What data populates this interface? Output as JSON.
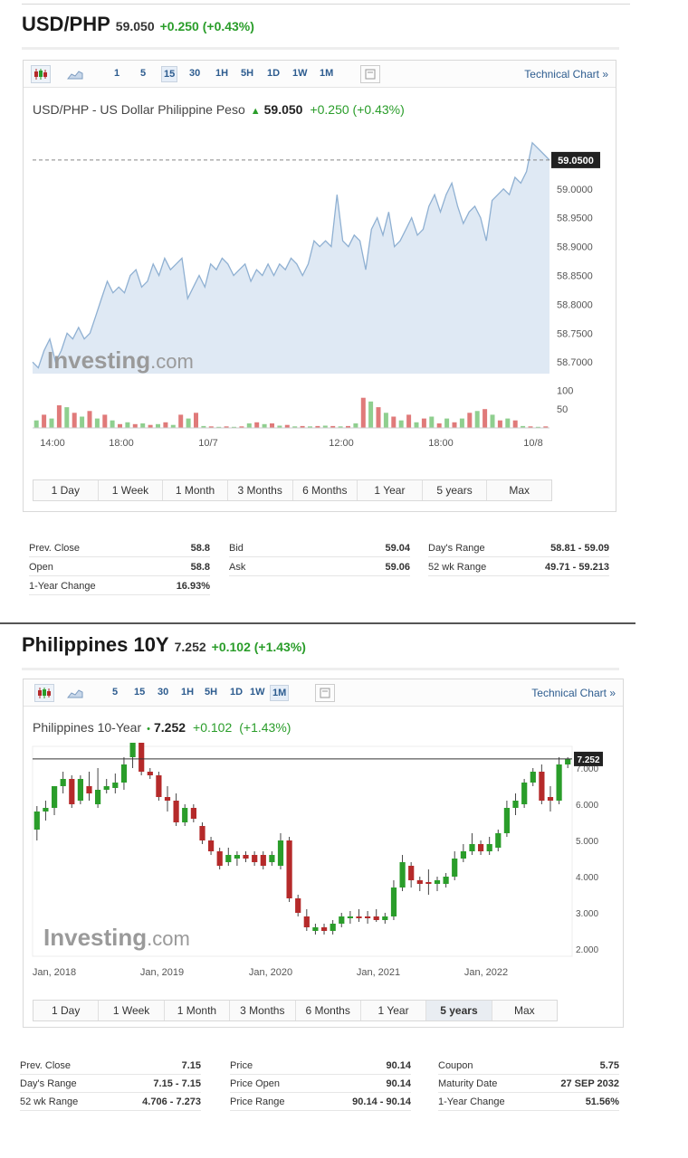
{
  "usd": {
    "title": "USD/PHP",
    "last": "59.050",
    "change": "+0.250 (+0.43%)",
    "toolbar": {
      "intervals": [
        "1",
        "5",
        "15",
        "30",
        "1H",
        "5H",
        "1D",
        "1W",
        "1M"
      ],
      "active_interval": "15",
      "technical_chart": "Technical Chart »"
    },
    "chart_title": {
      "name": "USD/PHP - US Dollar Philippine Peso",
      "arrow": "▲",
      "price": "59.050",
      "change": "+0.250 (+0.43%)"
    },
    "watermark": {
      "main": "Investing",
      "suffix": ".com"
    },
    "ranges": [
      "1 Day",
      "1 Week",
      "1 Month",
      "3 Months",
      "6 Months",
      "1 Year",
      "5 years",
      "Max"
    ],
    "stats": [
      [
        {
          "label": "Prev. Close",
          "value": "58.8"
        },
        {
          "label": "Bid",
          "value": "59.04"
        },
        {
          "label": "Day's Range",
          "value": "58.81 - 59.09"
        }
      ],
      [
        {
          "label": "Open",
          "value": "58.8"
        },
        {
          "label": "Ask",
          "value": "59.06"
        },
        {
          "label": "52 wk Range",
          "value": "49.71 - 59.213"
        }
      ],
      [
        {
          "label": "1-Year Change",
          "value": "16.93%"
        }
      ]
    ]
  },
  "ph10y": {
    "title": "Philippines 10Y",
    "last": "7.252",
    "change": "+0.102 (+1.43%)",
    "toolbar": {
      "intervals": [
        "5",
        "15",
        "30",
        "1H",
        "5H",
        "1D",
        "1W",
        "1M"
      ],
      "active_interval": "1M",
      "technical_chart": "Technical Chart »"
    },
    "chart_title": {
      "name": "Philippines 10-Year",
      "arrow": "•",
      "price": "7.252",
      "change": "+0.102",
      "change_pct": "(+1.43%)"
    },
    "watermark": {
      "main": "Investing",
      "suffix": ".com"
    },
    "ranges": [
      "1 Day",
      "1 Week",
      "1 Month",
      "3 Months",
      "6 Months",
      "1 Year",
      "5 years",
      "Max"
    ],
    "active_range": "5 years",
    "stats": [
      [
        {
          "label": "Prev. Close",
          "value": "7.15"
        },
        {
          "label": "Price",
          "value": "90.14"
        },
        {
          "label": "Coupon",
          "value": "5.75"
        }
      ],
      [
        {
          "label": "Day's Range",
          "value": "7.15 - 7.15"
        },
        {
          "label": "Price Open",
          "value": "90.14"
        },
        {
          "label": "Maturity Date",
          "value": "27 SEP 2032"
        }
      ],
      [
        {
          "label": "52 wk Range",
          "value": "4.706 - 7.273"
        },
        {
          "label": "Price Range",
          "value": "90.14 - 90.14"
        },
        {
          "label": "1-Year Change",
          "value": "51.56%"
        }
      ]
    ]
  },
  "colors": {
    "up": "#2a9d2a",
    "down": "#b52a2a",
    "area_fill": "#dfe9f4",
    "area_line": "#8fb0d2",
    "link": "#2d5c8f",
    "vol_up": "#8fcf8f",
    "vol_down": "#e07a7a"
  },
  "chart_data": [
    {
      "type": "area",
      "title": "USD/PHP - US Dollar Philippine Peso",
      "x_ticks": [
        "14:00",
        "18:00",
        "10/7",
        "12:00",
        "18:00",
        "10/8"
      ],
      "y_ticks": [
        "59.0000",
        "58.9500",
        "58.9000",
        "58.8500",
        "58.8000",
        "58.7500",
        "58.7000"
      ],
      "ylim": [
        58.68,
        59.1
      ],
      "current_value_label": "59.0500",
      "current_value": 59.05,
      "values": [
        58.7,
        58.69,
        58.72,
        58.74,
        58.7,
        58.72,
        58.75,
        58.74,
        58.76,
        58.74,
        58.75,
        58.78,
        58.81,
        58.84,
        58.82,
        58.83,
        58.82,
        58.85,
        58.86,
        58.83,
        58.84,
        58.87,
        58.85,
        58.88,
        58.86,
        58.87,
        58.88,
        58.81,
        58.83,
        58.85,
        58.83,
        58.87,
        58.86,
        58.88,
        58.87,
        58.85,
        58.86,
        58.87,
        58.84,
        58.86,
        58.85,
        58.87,
        58.85,
        58.87,
        58.86,
        58.88,
        58.87,
        58.85,
        58.87,
        58.91,
        58.9,
        58.91,
        58.9,
        58.99,
        58.91,
        58.9,
        58.92,
        58.91,
        58.86,
        58.93,
        58.95,
        58.92,
        58.96,
        58.9,
        58.91,
        58.93,
        58.95,
        58.92,
        58.93,
        58.97,
        58.99,
        58.96,
        58.99,
        59.01,
        58.97,
        58.94,
        58.96,
        58.97,
        58.95,
        58.91,
        58.98,
        58.99,
        59.0,
        58.99,
        59.02,
        59.01,
        59.03,
        59.08,
        59.07,
        59.06,
        59.05
      ],
      "volume_y_ticks": [
        "100",
        "50"
      ],
      "volume": [
        {
          "v": 20,
          "up": true
        },
        {
          "v": 35,
          "up": false
        },
        {
          "v": 25,
          "up": true
        },
        {
          "v": 60,
          "up": false
        },
        {
          "v": 55,
          "up": true
        },
        {
          "v": 40,
          "up": false
        },
        {
          "v": 30,
          "up": true
        },
        {
          "v": 45,
          "up": false
        },
        {
          "v": 25,
          "up": true
        },
        {
          "v": 35,
          "up": false
        },
        {
          "v": 20,
          "up": true
        },
        {
          "v": 10,
          "up": false
        },
        {
          "v": 15,
          "up": true
        },
        {
          "v": 10,
          "up": false
        },
        {
          "v": 12,
          "up": true
        },
        {
          "v": 8,
          "up": false
        },
        {
          "v": 10,
          "up": true
        },
        {
          "v": 15,
          "up": false
        },
        {
          "v": 8,
          "up": true
        },
        {
          "v": 35,
          "up": false
        },
        {
          "v": 25,
          "up": true
        },
        {
          "v": 40,
          "up": false
        },
        {
          "v": 5,
          "up": true
        },
        {
          "v": 4,
          "up": false
        },
        {
          "v": 3,
          "up": true
        },
        {
          "v": 4,
          "up": false
        },
        {
          "v": 3,
          "up": true
        },
        {
          "v": 4,
          "up": false
        },
        {
          "v": 12,
          "up": true
        },
        {
          "v": 15,
          "up": false
        },
        {
          "v": 10,
          "up": true
        },
        {
          "v": 12,
          "up": false
        },
        {
          "v": 6,
          "up": true
        },
        {
          "v": 8,
          "up": false
        },
        {
          "v": 4,
          "up": true
        },
        {
          "v": 5,
          "up": false
        },
        {
          "v": 4,
          "up": true
        },
        {
          "v": 5,
          "up": false
        },
        {
          "v": 6,
          "up": true
        },
        {
          "v": 5,
          "up": false
        },
        {
          "v": 4,
          "up": true
        },
        {
          "v": 5,
          "up": false
        },
        {
          "v": 12,
          "up": true
        },
        {
          "v": 80,
          "up": false
        },
        {
          "v": 70,
          "up": true
        },
        {
          "v": 55,
          "up": false
        },
        {
          "v": 40,
          "up": true
        },
        {
          "v": 30,
          "up": false
        },
        {
          "v": 20,
          "up": true
        },
        {
          "v": 35,
          "up": false
        },
        {
          "v": 15,
          "up": true
        },
        {
          "v": 25,
          "up": false
        },
        {
          "v": 30,
          "up": true
        },
        {
          "v": 12,
          "up": false
        },
        {
          "v": 25,
          "up": true
        },
        {
          "v": 15,
          "up": false
        },
        {
          "v": 25,
          "up": true
        },
        {
          "v": 40,
          "up": false
        },
        {
          "v": 45,
          "up": true
        },
        {
          "v": 50,
          "up": false
        },
        {
          "v": 35,
          "up": true
        },
        {
          "v": 20,
          "up": false
        },
        {
          "v": 25,
          "up": true
        },
        {
          "v": 20,
          "up": false
        },
        {
          "v": 5,
          "up": true
        },
        {
          "v": 4,
          "up": false
        },
        {
          "v": 3,
          "up": true
        },
        {
          "v": 4,
          "up": false
        }
      ]
    },
    {
      "type": "candlestick",
      "title": "Philippines 10-Year",
      "x_ticks": [
        "Jan, 2018",
        "Jan, 2019",
        "Jan, 2020",
        "Jan, 2021",
        "Jan, 2022"
      ],
      "y_ticks": [
        "7.000",
        "6.000",
        "5.000",
        "4.000",
        "3.000",
        "2.000"
      ],
      "ylim": [
        1.8,
        7.6
      ],
      "current_value_label": "7.252",
      "current_value": 7.252,
      "candles": [
        {
          "o": 5.3,
          "h": 5.95,
          "l": 5.0,
          "c": 5.8
        },
        {
          "o": 5.8,
          "h": 6.1,
          "l": 5.55,
          "c": 5.9
        },
        {
          "o": 5.9,
          "h": 6.2,
          "l": 5.7,
          "c": 6.5
        },
        {
          "o": 6.5,
          "h": 6.9,
          "l": 6.3,
          "c": 6.7
        },
        {
          "o": 6.7,
          "h": 6.8,
          "l": 5.9,
          "c": 6.0
        },
        {
          "o": 6.1,
          "h": 6.8,
          "l": 6.0,
          "c": 6.7
        },
        {
          "o": 6.5,
          "h": 6.9,
          "l": 6.1,
          "c": 6.3
        },
        {
          "o": 6.0,
          "h": 7.0,
          "l": 5.9,
          "c": 6.4
        },
        {
          "o": 6.4,
          "h": 6.7,
          "l": 6.3,
          "c": 6.5
        },
        {
          "o": 6.45,
          "h": 6.85,
          "l": 6.3,
          "c": 6.6
        },
        {
          "o": 6.6,
          "h": 7.3,
          "l": 6.4,
          "c": 7.1
        },
        {
          "o": 7.3,
          "h": 7.9,
          "l": 7.0,
          "c": 7.7
        },
        {
          "o": 7.8,
          "h": 7.8,
          "l": 6.8,
          "c": 6.9
        },
        {
          "o": 6.9,
          "h": 7.0,
          "l": 6.7,
          "c": 6.8
        },
        {
          "o": 6.8,
          "h": 6.9,
          "l": 6.1,
          "c": 6.2
        },
        {
          "o": 6.2,
          "h": 6.5,
          "l": 5.8,
          "c": 6.1
        },
        {
          "o": 6.1,
          "h": 6.3,
          "l": 5.4,
          "c": 5.5
        },
        {
          "o": 5.5,
          "h": 6.0,
          "l": 5.4,
          "c": 5.9
        },
        {
          "o": 5.9,
          "h": 6.0,
          "l": 5.5,
          "c": 5.6
        },
        {
          "o": 5.4,
          "h": 5.5,
          "l": 4.9,
          "c": 5.0
        },
        {
          "o": 5.0,
          "h": 5.1,
          "l": 4.6,
          "c": 4.7
        },
        {
          "o": 4.7,
          "h": 4.8,
          "l": 4.2,
          "c": 4.3
        },
        {
          "o": 4.4,
          "h": 4.8,
          "l": 4.3,
          "c": 4.6
        },
        {
          "o": 4.5,
          "h": 4.7,
          "l": 4.3,
          "c": 4.6
        },
        {
          "o": 4.6,
          "h": 4.7,
          "l": 4.4,
          "c": 4.5
        },
        {
          "o": 4.6,
          "h": 4.7,
          "l": 4.3,
          "c": 4.4
        },
        {
          "o": 4.6,
          "h": 4.7,
          "l": 4.2,
          "c": 4.3
        },
        {
          "o": 4.4,
          "h": 4.7,
          "l": 4.3,
          "c": 4.6
        },
        {
          "o": 4.3,
          "h": 5.2,
          "l": 4.2,
          "c": 5.0
        },
        {
          "o": 5.0,
          "h": 5.1,
          "l": 3.3,
          "c": 3.4
        },
        {
          "o": 3.4,
          "h": 3.5,
          "l": 2.9,
          "c": 3.0
        },
        {
          "o": 2.9,
          "h": 3.1,
          "l": 2.5,
          "c": 2.6
        },
        {
          "o": 2.5,
          "h": 2.7,
          "l": 2.4,
          "c": 2.6
        },
        {
          "o": 2.6,
          "h": 2.7,
          "l": 2.4,
          "c": 2.5
        },
        {
          "o": 2.5,
          "h": 2.8,
          "l": 2.4,
          "c": 2.7
        },
        {
          "o": 2.7,
          "h": 3.0,
          "l": 2.6,
          "c": 2.9
        },
        {
          "o": 2.85,
          "h": 3.05,
          "l": 2.7,
          "c": 2.9
        },
        {
          "o": 2.9,
          "h": 3.1,
          "l": 2.75,
          "c": 2.85
        },
        {
          "o": 2.9,
          "h": 3.05,
          "l": 2.7,
          "c": 2.85
        },
        {
          "o": 2.9,
          "h": 3.1,
          "l": 2.75,
          "c": 2.8
        },
        {
          "o": 2.8,
          "h": 3.0,
          "l": 2.7,
          "c": 2.9
        },
        {
          "o": 2.9,
          "h": 3.9,
          "l": 2.8,
          "c": 3.7
        },
        {
          "o": 3.7,
          "h": 4.6,
          "l": 3.6,
          "c": 4.4
        },
        {
          "o": 4.3,
          "h": 4.4,
          "l": 3.7,
          "c": 3.9
        },
        {
          "o": 3.9,
          "h": 4.0,
          "l": 3.6,
          "c": 3.8
        },
        {
          "o": 3.85,
          "h": 4.2,
          "l": 3.5,
          "c": 3.8
        },
        {
          "o": 3.8,
          "h": 4.0,
          "l": 3.6,
          "c": 3.9
        },
        {
          "o": 3.8,
          "h": 4.1,
          "l": 3.7,
          "c": 4.0
        },
        {
          "o": 4.0,
          "h": 4.7,
          "l": 3.9,
          "c": 4.5
        },
        {
          "o": 4.5,
          "h": 4.9,
          "l": 4.4,
          "c": 4.7
        },
        {
          "o": 4.7,
          "h": 5.2,
          "l": 4.6,
          "c": 4.9
        },
        {
          "o": 4.9,
          "h": 5.0,
          "l": 4.6,
          "c": 4.7
        },
        {
          "o": 4.7,
          "h": 5.1,
          "l": 4.6,
          "c": 4.9
        },
        {
          "o": 4.8,
          "h": 5.3,
          "l": 4.7,
          "c": 5.2
        },
        {
          "o": 5.2,
          "h": 6.1,
          "l": 5.1,
          "c": 5.9
        },
        {
          "o": 5.9,
          "h": 6.3,
          "l": 5.7,
          "c": 6.1
        },
        {
          "o": 6.0,
          "h": 6.7,
          "l": 5.9,
          "c": 6.6
        },
        {
          "o": 6.6,
          "h": 7.0,
          "l": 6.5,
          "c": 6.9
        },
        {
          "o": 6.9,
          "h": 7.1,
          "l": 6.0,
          "c": 6.1
        },
        {
          "o": 6.2,
          "h": 6.5,
          "l": 5.8,
          "c": 6.1
        },
        {
          "o": 6.1,
          "h": 7.3,
          "l": 6.0,
          "c": 7.1
        },
        {
          "o": 7.1,
          "h": 7.3,
          "l": 7.0,
          "c": 7.25
        }
      ]
    }
  ]
}
